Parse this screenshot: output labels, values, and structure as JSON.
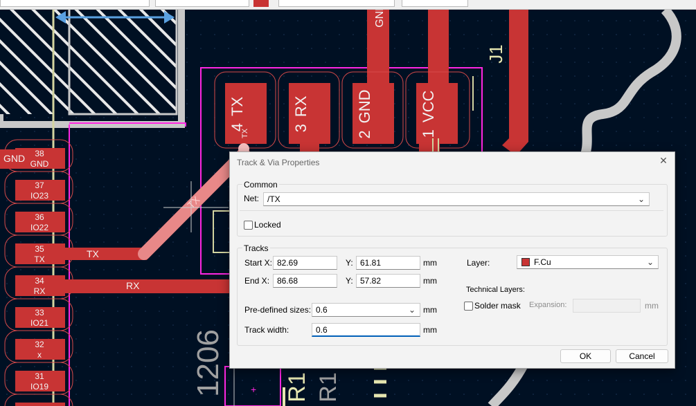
{
  "pcb": {
    "ref_j1": "J1",
    "ref_r1": "R1",
    "ref_r1_mirror": "R1",
    "ref_1206": "1206",
    "side_gnd_label": "GND",
    "pads": [
      {
        "num": "4",
        "name": "TX",
        "small": "TX"
      },
      {
        "num": "3",
        "name": "RX"
      },
      {
        "num": "2",
        "name": "GND"
      },
      {
        "num": "1",
        "name": "VCC"
      }
    ],
    "top_gnd_label": "GND",
    "header_pins": [
      {
        "num": "38",
        "name": "GND"
      },
      {
        "num": "37",
        "name": "IO23"
      },
      {
        "num": "36",
        "name": "IO22"
      },
      {
        "num": "35",
        "name": "TX"
      },
      {
        "num": "34",
        "name": "RX"
      },
      {
        "num": "33",
        "name": "IO21"
      },
      {
        "num": "32",
        "name": "x"
      },
      {
        "num": "31",
        "name": "IO19"
      }
    ],
    "track_labels": {
      "tx": "TX",
      "rx": "RX",
      "selected": "TX"
    },
    "colors": {
      "copper": "#c83434",
      "background": "#001023",
      "silkscreen": "#e8e8e8",
      "courtyard": "#ff26e2",
      "edge": "#c8c8c8",
      "fab": "#d4d4a0"
    }
  },
  "dialog": {
    "title": "Track & Via Properties",
    "common_label": "Common",
    "net_label": "Net:",
    "net_value": "/TX",
    "locked_label": "Locked",
    "locked_checked": false,
    "tracks_label": "Tracks",
    "start_x_label": "Start X:",
    "start_x": "82.69",
    "start_y_label": "Y:",
    "start_y": "61.81",
    "end_x_label": "End X:",
    "end_x": "86.68",
    "end_y_label": "Y:",
    "end_y": "57.82",
    "unit": "mm",
    "layer_label": "Layer:",
    "layer_value": "F.Cu",
    "layer_color": "#c83434",
    "tech_layers_label": "Technical Layers:",
    "solder_mask_label": "Solder mask",
    "solder_mask_checked": false,
    "expansion_label": "Expansion:",
    "expansion_value": "",
    "predef_label": "Pre-defined sizes:",
    "predef_value": "0.6",
    "track_width_label": "Track width:",
    "track_width_value": "0.6",
    "ok_label": "OK",
    "cancel_label": "Cancel"
  }
}
